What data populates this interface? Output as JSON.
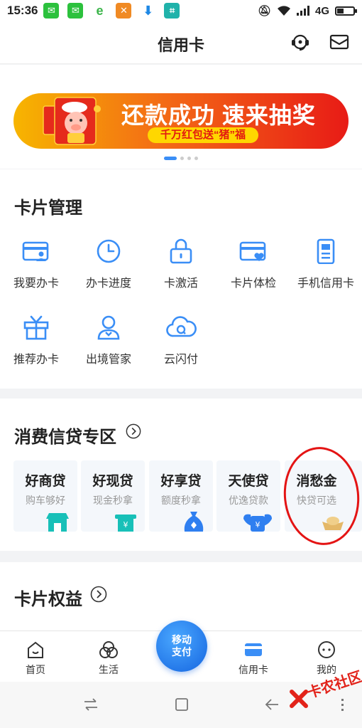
{
  "status_bar": {
    "time": "15:36",
    "network": "4G"
  },
  "header": {
    "title": "信用卡"
  },
  "banner": {
    "title": "还款成功 速来抽奖",
    "subtitle": "千万红包送“猪”福"
  },
  "card_management": {
    "title": "卡片管理",
    "items": [
      {
        "label": "我要办卡",
        "icon": "apply-card-icon"
      },
      {
        "label": "办卡进度",
        "icon": "clock-icon"
      },
      {
        "label": "卡激活",
        "icon": "lock-icon"
      },
      {
        "label": "卡片体检",
        "icon": "card-heart-icon"
      },
      {
        "label": "手机信用卡",
        "icon": "phone-card-icon"
      },
      {
        "label": "推荐办卡",
        "icon": "gift-icon"
      },
      {
        "label": "出境管家",
        "icon": "butler-icon"
      },
      {
        "label": "云闪付",
        "icon": "cloud-pay-icon"
      }
    ]
  },
  "credit_zone": {
    "title": "消费信贷专区",
    "products": [
      {
        "name": "好商贷",
        "desc": "购车够好"
      },
      {
        "name": "好现贷",
        "desc": "现金秒拿"
      },
      {
        "name": "好享贷",
        "desc": "额度秒拿"
      },
      {
        "name": "天使贷",
        "desc": "优逸贷款"
      },
      {
        "name": "消愁金",
        "desc": "快贷可选"
      }
    ]
  },
  "card_benefits": {
    "title": "卡片权益"
  },
  "tabbar": {
    "tabs": [
      {
        "label": "首页"
      },
      {
        "label": "生活"
      },
      {
        "label": "信用卡"
      },
      {
        "label": "我的"
      }
    ],
    "center_button": {
      "line1": "移动",
      "line2": "支付"
    }
  },
  "watermark": {
    "text": "卡农社区"
  },
  "colors": {
    "accent": "#3a8ef6",
    "banner_red": "#e81b16",
    "banner_yellow": "#ffd700",
    "annotation_red": "#e41414"
  }
}
